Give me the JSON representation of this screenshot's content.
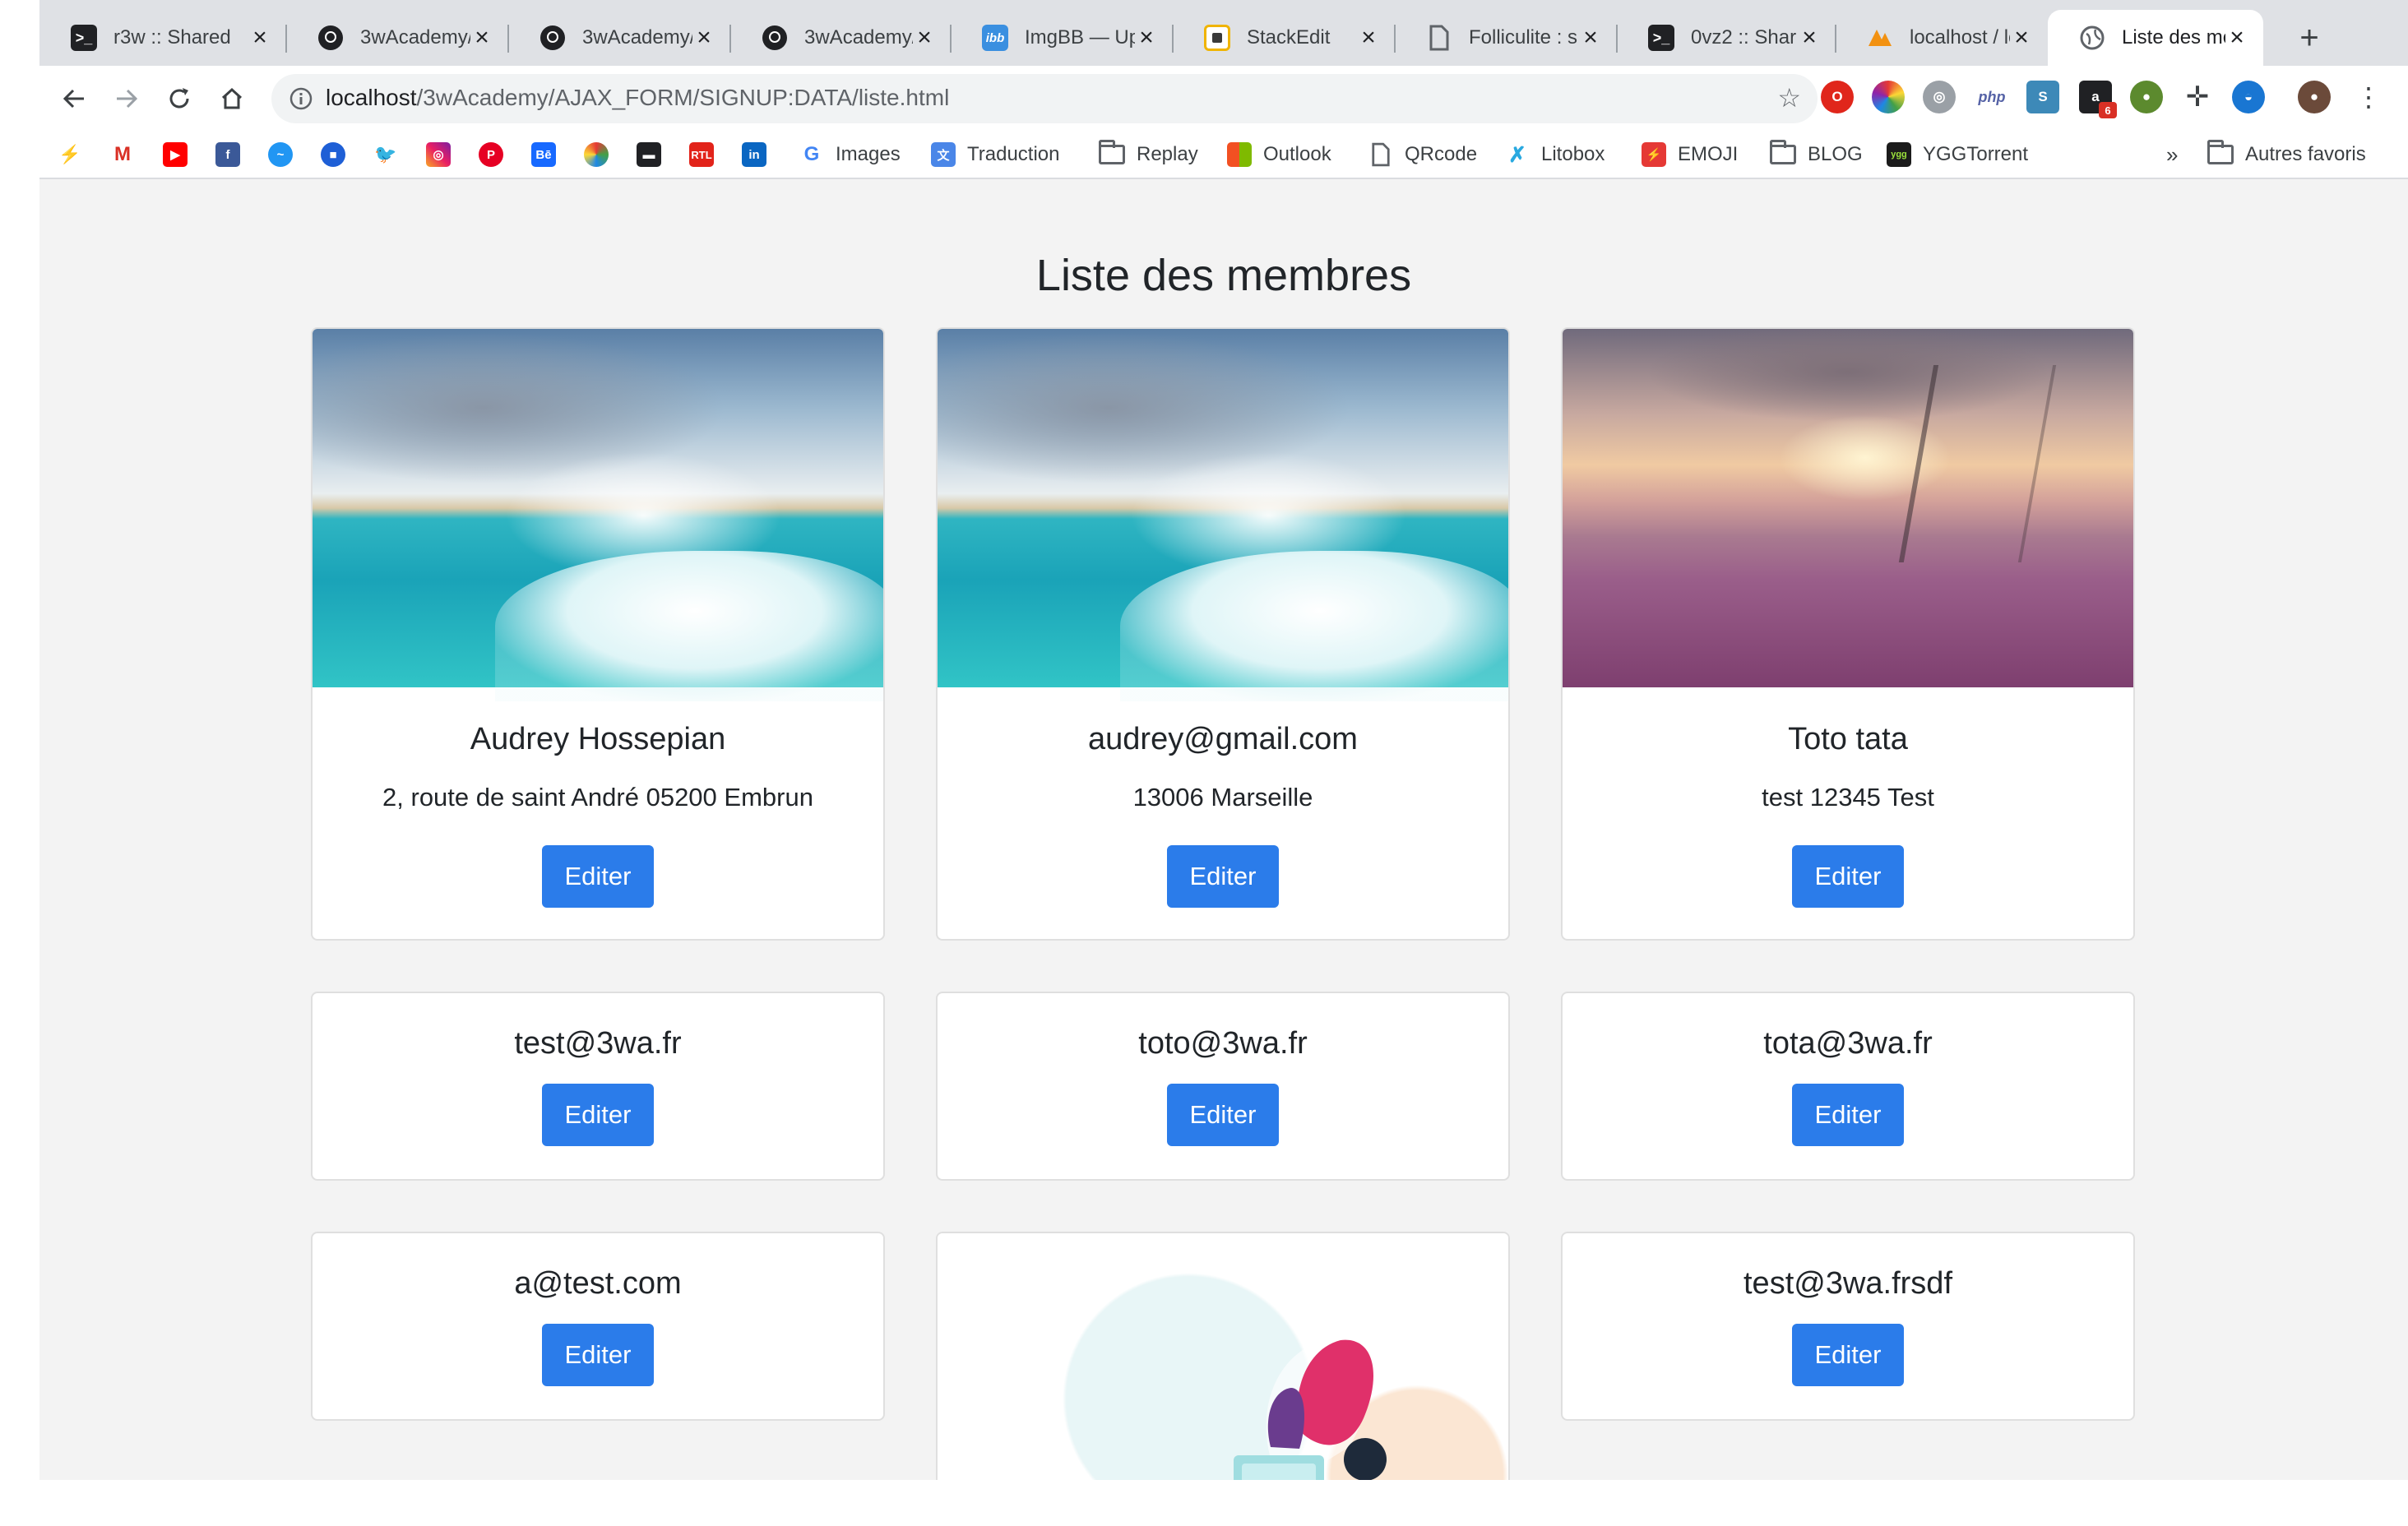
{
  "browser": {
    "tabs": [
      {
        "title": "r3w :: Shared",
        "icon": "terminal-icon",
        "active": false
      },
      {
        "title": "3wAcademy/",
        "icon": "github-icon",
        "active": false
      },
      {
        "title": "3wAcademy/",
        "icon": "github-icon",
        "active": false
      },
      {
        "title": "3wAcademy/",
        "icon": "github-icon",
        "active": false
      },
      {
        "title": "ImgBB — Up",
        "icon": "imgbb-icon",
        "active": false
      },
      {
        "title": "StackEdit",
        "icon": "stackedit-icon",
        "active": false
      },
      {
        "title": "Folliculite : s",
        "icon": "document-icon",
        "active": false
      },
      {
        "title": "0vz2 :: Shar",
        "icon": "terminal-icon",
        "active": false
      },
      {
        "title": "localhost / lo",
        "icon": "phpmyadmin-icon",
        "active": false
      },
      {
        "title": "Liste des me",
        "icon": "globe-icon",
        "active": true
      }
    ],
    "url_host": "localhost",
    "url_path": "/3wAcademy/AJAX_FORM/SIGNUP:DATA/liste.html",
    "bookmarks": [
      {
        "label": "Images",
        "icon": "google-icon"
      },
      {
        "label": "Traduction",
        "icon": "translate-icon"
      },
      {
        "label": "Replay",
        "icon": "folder-icon"
      },
      {
        "label": "Outlook",
        "icon": "microsoft-icon"
      },
      {
        "label": "QRcode",
        "icon": "document-icon"
      },
      {
        "label": "Litobox",
        "icon": "litobox-icon"
      },
      {
        "label": "EMOJI",
        "icon": "emoji-icon"
      },
      {
        "label": "BLOG",
        "icon": "folder-icon"
      },
      {
        "label": "YGGTorrent",
        "icon": "ygg-icon"
      }
    ],
    "bookmarks_overflow": "»",
    "other_bookmarks": "Autres favoris",
    "bookmark_icon_texts": {
      "behance": "Bē",
      "rtl": "RTL",
      "linkedin": "in",
      "php": "php",
      "amazon": "a",
      "amazon_badge": "6"
    }
  },
  "page": {
    "title": "Liste des membres",
    "button_label": "Editer",
    "members": [
      {
        "name": "Audrey Hossepian",
        "address": "2, route de saint André 05200 Embrun",
        "image": "sea"
      },
      {
        "name": "audrey@gmail.com",
        "address": "13006 Marseille",
        "image": "sea"
      },
      {
        "name": "Toto tata",
        "address": "test 12345 Test",
        "image": "heath"
      },
      {
        "name": "test@3wa.fr",
        "address": "",
        "image": ""
      },
      {
        "name": "toto@3wa.fr",
        "address": "",
        "image": ""
      },
      {
        "name": "tota@3wa.fr",
        "address": "",
        "image": ""
      },
      {
        "name": "a@test.com",
        "address": "",
        "image": ""
      },
      {
        "name": "",
        "address": "",
        "image": "illustration"
      },
      {
        "name": "test@3wa.frsdf",
        "address": "",
        "image": ""
      }
    ]
  }
}
